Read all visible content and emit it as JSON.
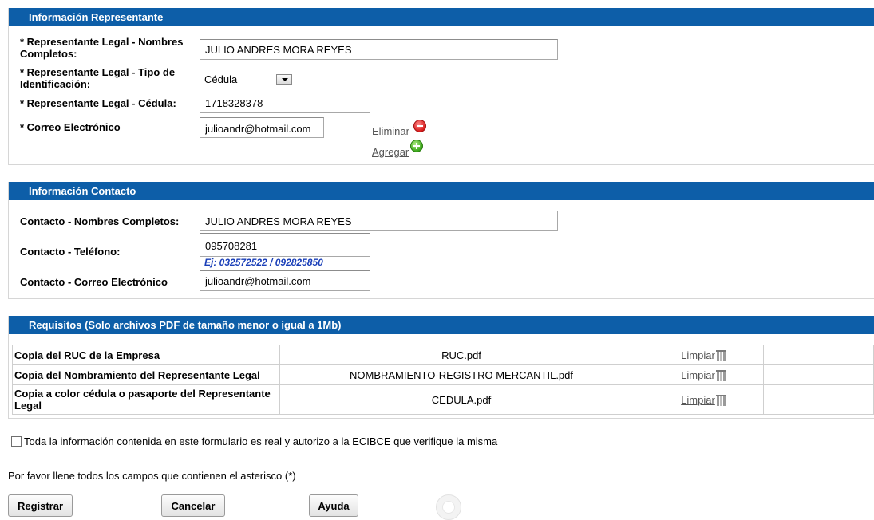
{
  "representante": {
    "header": "Información Representante",
    "nombres_label": "* Representante Legal - Nombres Completos:",
    "nombres_value": "JULIO ANDRES MORA REYES",
    "tipo_id_label": "* Representante Legal - Tipo de Identificación:",
    "tipo_id_value": "Cédula",
    "cedula_label": "* Representante Legal - Cédula:",
    "cedula_value": "1718328378",
    "correo_label": "* Correo Electrónico",
    "correo_value": "julioandr@hotmail.com",
    "eliminar_label": "Eliminar",
    "agregar_label": "Agregar"
  },
  "contacto": {
    "header": "Información Contacto",
    "nombres_label": "Contacto - Nombres Completos:",
    "nombres_value": "JULIO ANDRES MORA REYES",
    "telefono_label": "Contacto - Teléfono:",
    "telefono_value": "095708281",
    "telefono_hint": "Ej: 032572522 / 092825850",
    "correo_label": "Contacto - Correo Electrónico",
    "correo_value": "julioandr@hotmail.com"
  },
  "requisitos": {
    "header": "Requisitos (Solo archivos PDF de tamaño menor o igual a 1Mb)",
    "rows": [
      {
        "label": "Copia del RUC de la Empresa",
        "file": "RUC.pdf",
        "action": "Limpiar"
      },
      {
        "label": "Copia del Nombramiento del Representante Legal",
        "file": "NOMBRAMIENTO-REGISTRO MERCANTIL.pdf",
        "action": "Limpiar"
      },
      {
        "label": "Copia a color cédula o pasaporte del Representante Legal",
        "file": "CEDULA.pdf",
        "action": "Limpiar"
      }
    ]
  },
  "declaracion": {
    "checked": false,
    "text": "Toda la información contenida en este formulario es real y autorizo a la ECIBCE que verifique la misma"
  },
  "notice": "Por favor llene todos los campos que contienen el asterisco (*)",
  "buttons": {
    "registrar": "Registrar",
    "cancelar": "Cancelar",
    "ayuda": "Ayuda"
  },
  "colors": {
    "header_bg": "#0d5ea8",
    "hint_text": "#1a3fb8"
  }
}
